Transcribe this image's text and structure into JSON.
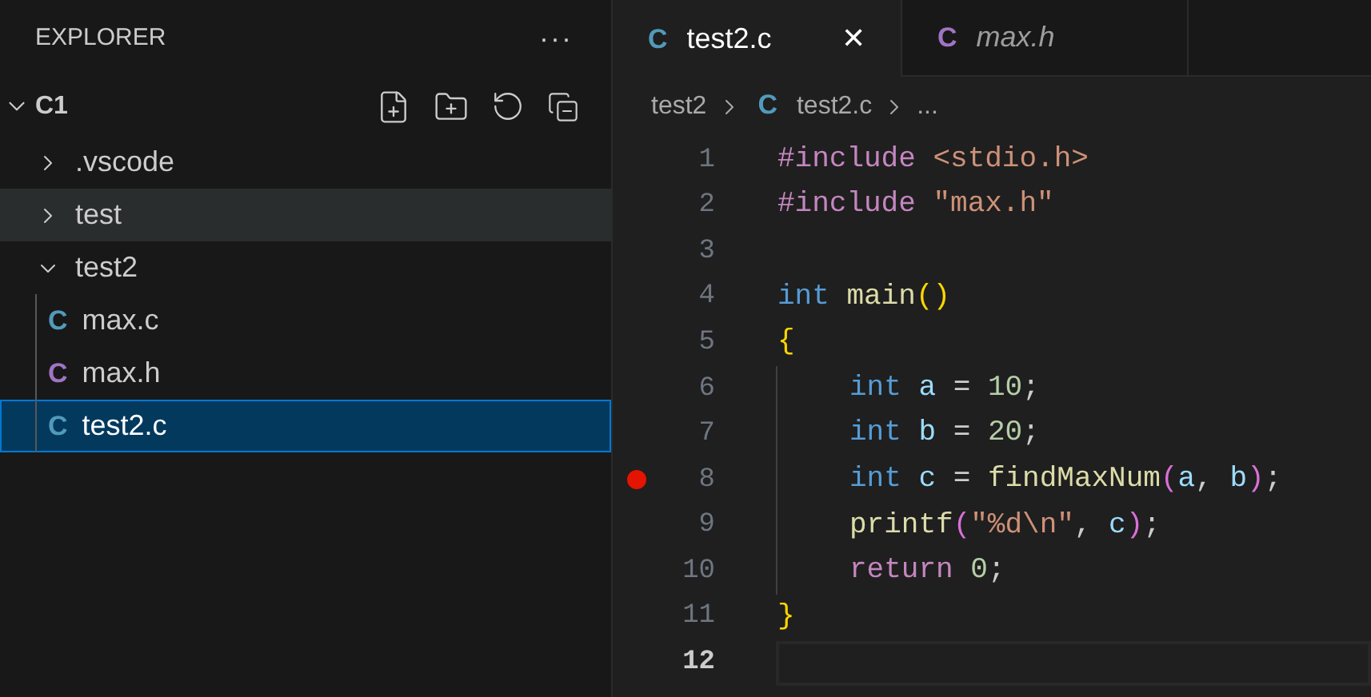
{
  "sidebar": {
    "title": "EXPLORER",
    "more": "···",
    "root": {
      "label": "C1",
      "expanded": true
    },
    "tree": [
      {
        "label": ".vscode",
        "kind": "folder",
        "expanded": false,
        "hovered": false,
        "selected": false
      },
      {
        "label": "test",
        "kind": "folder",
        "expanded": false,
        "hovered": true,
        "selected": false
      },
      {
        "label": "test2",
        "kind": "folder",
        "expanded": true,
        "hovered": false,
        "selected": false,
        "children": [
          {
            "label": "max.c",
            "kind": "source",
            "icon": "C",
            "hovered": false,
            "selected": false
          },
          {
            "label": "max.h",
            "kind": "header",
            "icon": "C",
            "hovered": false,
            "selected": false
          },
          {
            "label": "test2.c",
            "kind": "source",
            "icon": "C",
            "hovered": false,
            "selected": true
          }
        ]
      }
    ]
  },
  "tabs": [
    {
      "label": "test2.c",
      "kind": "source",
      "icon": "C",
      "selected": true,
      "preview": false,
      "close": "✕"
    },
    {
      "label": "max.h",
      "kind": "header",
      "icon": "C",
      "selected": false,
      "preview": true
    }
  ],
  "breadcrumb": [
    {
      "text": "test2",
      "kind": "folder"
    },
    {
      "text": "test2.c",
      "kind": "source",
      "icon": "C"
    },
    {
      "text": "...",
      "kind": "more"
    }
  ],
  "editor": {
    "lines": [
      {
        "number": "1",
        "indented": false,
        "breakpoint": false,
        "current": false,
        "tokens": [
          {
            "kind": "directive",
            "text": "#include "
          },
          {
            "kind": "string",
            "text": "<stdio.h>"
          }
        ]
      },
      {
        "number": "2",
        "indented": false,
        "breakpoint": false,
        "current": false,
        "tokens": [
          {
            "kind": "directive",
            "text": "#include "
          },
          {
            "kind": "string",
            "text": "\"max.h\""
          }
        ]
      },
      {
        "number": "3",
        "breakpoint": false,
        "current": false
      },
      {
        "number": "4",
        "indented": false,
        "breakpoint": false,
        "current": false,
        "tokens": [
          {
            "kind": "keyword",
            "text": "int "
          },
          {
            "kind": "function",
            "text": "main"
          },
          {
            "kind": "bracket",
            "text": "()"
          }
        ]
      },
      {
        "number": "5",
        "indented": false,
        "breakpoint": false,
        "current": false,
        "tokens": [
          {
            "kind": "bracket",
            "text": "{"
          }
        ]
      },
      {
        "number": "6",
        "indented": true,
        "breakpoint": false,
        "current": false,
        "tokens": [
          {
            "kind": "keyword",
            "text": "int "
          },
          {
            "kind": "variable",
            "text": "a"
          },
          {
            "kind": "plain",
            "text": " = "
          },
          {
            "kind": "number",
            "text": "10"
          },
          {
            "kind": "plain",
            "text": ";"
          }
        ]
      },
      {
        "number": "7",
        "indented": true,
        "breakpoint": false,
        "current": false,
        "tokens": [
          {
            "kind": "keyword",
            "text": "int "
          },
          {
            "kind": "variable",
            "text": "b"
          },
          {
            "kind": "plain",
            "text": " = "
          },
          {
            "kind": "number",
            "text": "20"
          },
          {
            "kind": "plain",
            "text": ";"
          }
        ]
      },
      {
        "number": "8",
        "indented": true,
        "breakpoint": true,
        "current": false,
        "tokens": [
          {
            "kind": "keyword",
            "text": "int "
          },
          {
            "kind": "variable",
            "text": "c"
          },
          {
            "kind": "plain",
            "text": " = "
          },
          {
            "kind": "function",
            "text": "findMaxNum"
          },
          {
            "kind": "bracket2",
            "text": "("
          },
          {
            "kind": "variable",
            "text": "a"
          },
          {
            "kind": "plain",
            "text": ", "
          },
          {
            "kind": "variable",
            "text": "b"
          },
          {
            "kind": "bracket2",
            "text": ")"
          },
          {
            "kind": "plain",
            "text": ";"
          }
        ]
      },
      {
        "number": "9",
        "indented": true,
        "breakpoint": false,
        "current": false,
        "tokens": [
          {
            "kind": "function",
            "text": "printf"
          },
          {
            "kind": "bracket2",
            "text": "("
          },
          {
            "kind": "string",
            "text": "\"%d\\n\""
          },
          {
            "kind": "plain",
            "text": ", "
          },
          {
            "kind": "variable",
            "text": "c"
          },
          {
            "kind": "bracket2",
            "text": ")"
          },
          {
            "kind": "plain",
            "text": ";"
          }
        ]
      },
      {
        "number": "10",
        "indented": true,
        "breakpoint": false,
        "current": false,
        "tokens": [
          {
            "kind": "control",
            "text": "return "
          },
          {
            "kind": "number",
            "text": "0"
          },
          {
            "kind": "plain",
            "text": ";"
          }
        ]
      },
      {
        "number": "11",
        "indented": false,
        "breakpoint": false,
        "current": false,
        "tokens": [
          {
            "kind": "bracket",
            "text": "}"
          }
        ]
      },
      {
        "number": "12",
        "breakpoint": false,
        "current": true
      }
    ]
  }
}
